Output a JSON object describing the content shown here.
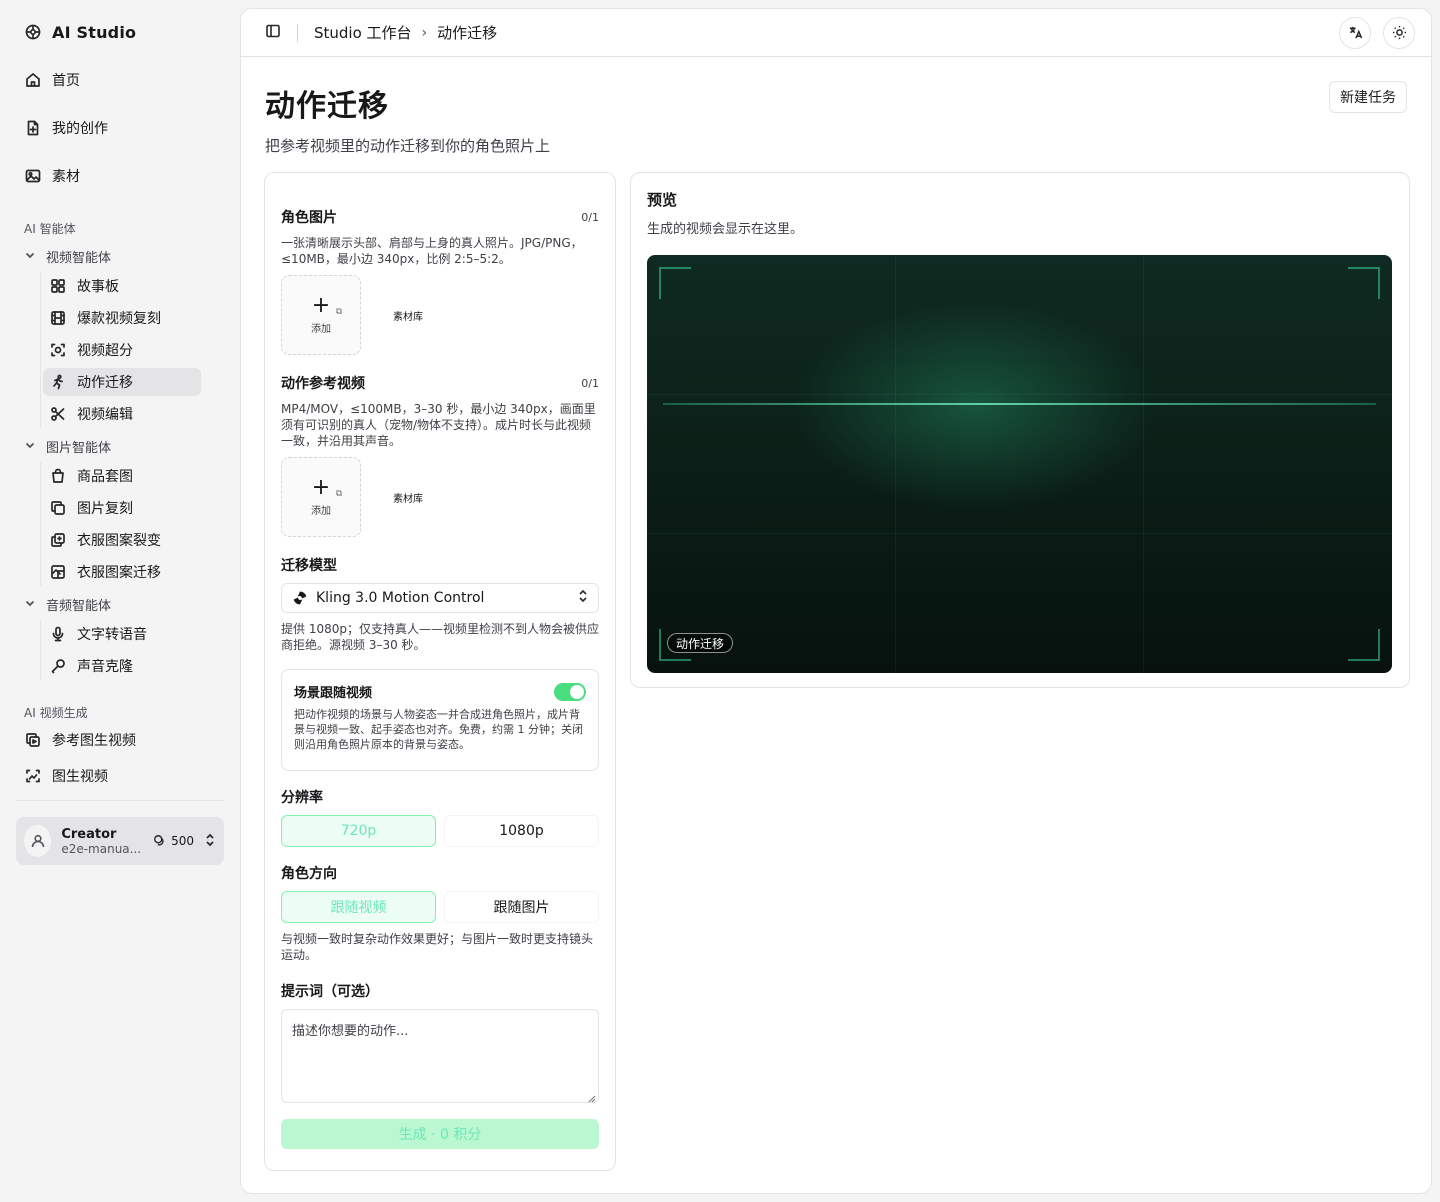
{
  "app": {
    "name": "AI Studio"
  },
  "sidebar": {
    "main_items": [
      {
        "label": "首页",
        "icon": "home-icon"
      },
      {
        "label": "我的创作",
        "icon": "file-icon"
      },
      {
        "label": "素材",
        "icon": "image-icon"
      }
    ],
    "agents_label": "AI 智能体",
    "groups": [
      {
        "label": "视频智能体",
        "items": [
          "故事板",
          "爆款视频复刻",
          "视频超分",
          "动作迁移",
          "视频编辑"
        ]
      },
      {
        "label": "图片智能体",
        "items": [
          "商品套图",
          "图片复刻",
          "衣服图案裂变",
          "衣服图案迁移"
        ]
      },
      {
        "label": "音频智能体",
        "items": [
          "文字转语音",
          "声音克隆"
        ]
      }
    ],
    "video_gen_label": "AI 视频生成",
    "video_gen_items": [
      "参考图生视频",
      "图生视频"
    ],
    "user": {
      "name": "Creator",
      "email": "e2e-manua...",
      "credits": "500"
    }
  },
  "header": {
    "crumb_root": "Studio 工作台",
    "crumb_sep": "›",
    "crumb_current": "动作迁移"
  },
  "page": {
    "title": "动作迁移",
    "subtitle": "把参考视频里的动作迁移到你的角色照片上",
    "new_task": "新建任务"
  },
  "form": {
    "character": {
      "label": "角色图片",
      "count": "0/1",
      "hint": "一张清晰展示头部、肩部与上身的真人照片。JPG/PNG，≤10MB，最小边 340px，比例 2:5–5:2。",
      "add": "添加",
      "library": "素材库"
    },
    "reference": {
      "label": "动作参考视频",
      "count": "0/1",
      "hint": "MP4/MOV，≤100MB，3–30 秒，最小边 340px，画面里须有可识别的真人（宠物/物体不支持）。成片时长与此视频一致，并沿用其声音。",
      "add": "添加",
      "library": "素材库"
    },
    "model": {
      "label": "迁移模型",
      "value": "Kling 3.0 Motion Control",
      "hint": "提供 1080p；仅支持真人——视频里检测不到人物会被供应商拒绝。源视频 3–30 秒。"
    },
    "scene": {
      "label": "场景跟随视频",
      "enabled": true,
      "desc": "把动作视频的场景与人物姿态一并合成进角色照片，成片背景与视频一致、起手姿态也对齐。免费，约需 1 分钟；关闭则沿用角色照片原本的背景与姿态。"
    },
    "resolution": {
      "label": "分辨率",
      "options": [
        "720p",
        "1080p"
      ],
      "selected": "720p"
    },
    "orientation": {
      "label": "角色方向",
      "options": [
        "跟随视频",
        "跟随图片"
      ],
      "selected": "跟随视频",
      "hint": "与视频一致时复杂动作效果更好；与图片一致时更支持镜头运动。"
    },
    "prompt": {
      "label": "提示词（可选）",
      "placeholder": "描述你想要的动作..."
    },
    "generate": "生成 · 0 积分"
  },
  "preview": {
    "title": "预览",
    "subtitle": "生成的视频会显示在这里。",
    "tag": "动作迁移"
  },
  "colors": {
    "accent": "#34d399",
    "accent_soft": "#bbf7d0",
    "stage_dark": "#07120e"
  }
}
